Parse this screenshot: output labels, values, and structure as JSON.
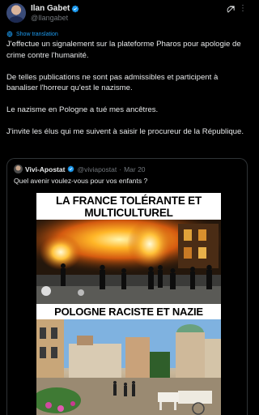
{
  "author": {
    "name": "Ilan Gabet",
    "handle": "@Ilangabet"
  },
  "translate_label": "Show translation",
  "tweet": {
    "paragraphs": [
      "J'effectue un signalement sur la plateforme Pharos pour apologie de crime contre l'humanité.",
      "De telles publications ne sont pas admissibles et participent à banaliser l'horreur qu'est le nazisme.",
      "Le nazisme en Pologne a tué mes ancêtres.",
      "J'invite les élus qui me suivent à saisir le procureur de la République."
    ]
  },
  "quote": {
    "name": "Vivi-Apostat",
    "handle": "@viviapostat",
    "separator": "·",
    "date": "Mar 20",
    "text": "Quel avenir voulez-vous pour vos enfants ?",
    "image": {
      "top_caption": "LA FRANCE TOLÉRANTE ET MULTICULTUREL",
      "bottom_caption": "POLOGNE RACISTE ET NAZIE"
    }
  },
  "icons": {
    "verified": "verified-badge-icon",
    "grok": "grok-icon",
    "more": "more-options-icon",
    "globe": "globe-icon"
  },
  "colors": {
    "background": "#000000",
    "text": "#e7e9ea",
    "muted": "#71767b",
    "accent": "#1d9bf0",
    "border": "#2f3336"
  }
}
